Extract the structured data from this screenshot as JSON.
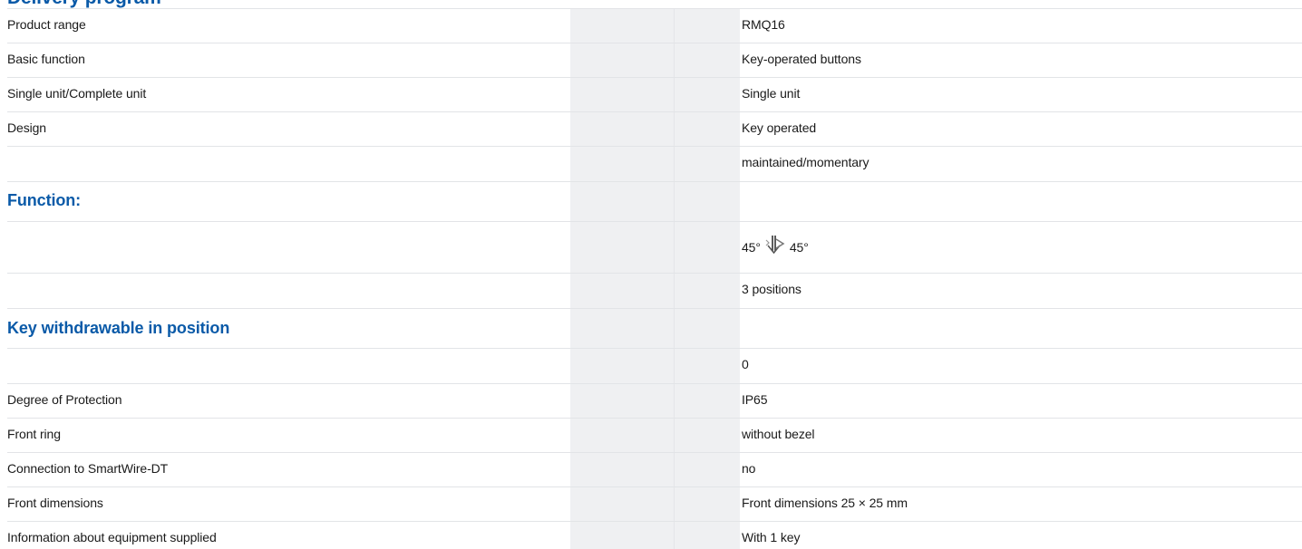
{
  "heading_partial": "Delivery program",
  "rows": [
    {
      "label": "Product range",
      "value": "RMQ16"
    },
    {
      "label": "Basic function",
      "value": "Key-operated buttons"
    },
    {
      "label": "Single unit/Complete unit",
      "value": "Single unit"
    },
    {
      "label": "Design",
      "value": "Key operated"
    },
    {
      "label": "",
      "value": "maintained/momentary"
    },
    {
      "label": "Function:",
      "value": ""
    },
    {
      "label": "",
      "value_left": "45°",
      "value_right": "45°",
      "icon": "key-switch-symbol-icon"
    },
    {
      "label": "",
      "value": "3 positions"
    },
    {
      "label": "Key withdrawable in position",
      "value": ""
    },
    {
      "label": "",
      "value": "0"
    },
    {
      "label": "Degree of Protection",
      "value": "IP65"
    },
    {
      "label": "Front ring",
      "value": "without bezel"
    },
    {
      "label": "Connection to SmartWire-DT",
      "value": "no"
    },
    {
      "label": "Front dimensions",
      "value": "Front dimensions 25 × 25 mm"
    },
    {
      "label": "Information about equipment supplied",
      "value": "With 1 key"
    }
  ],
  "colors": {
    "section_heading": "#0a5aa8",
    "text": "#1a1a1a",
    "row_border": "#e2e4e7",
    "middle_column": "#eff0f2"
  }
}
